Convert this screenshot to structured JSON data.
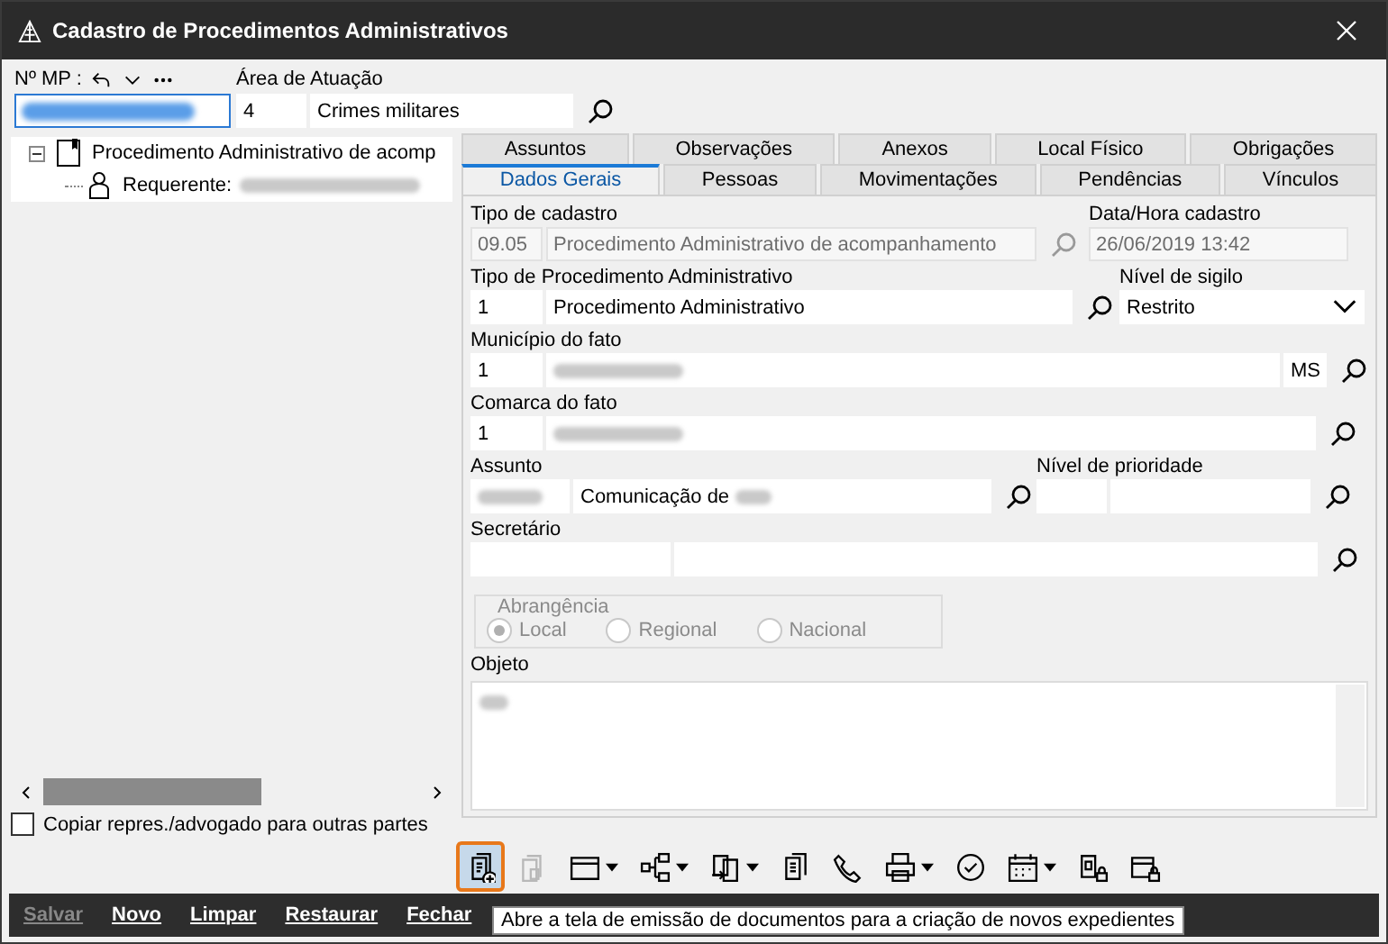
{
  "window": {
    "title": "Cadastro de Procedimentos Administrativos"
  },
  "header": {
    "mp_label": "Nº MP :",
    "area_label": "Área de Atuação",
    "area_code": "4",
    "area_name": "Crimes militares"
  },
  "tree": [
    {
      "label": "Procedimento Administrativo de acomp",
      "expanded": true,
      "children": [
        {
          "label": "Requerente:"
        }
      ]
    }
  ],
  "copy_checkbox": {
    "label": "Copiar repres./advogado para outras partes",
    "checked": false
  },
  "tabs": {
    "back_row": [
      {
        "label": "Assuntos",
        "selected": false
      },
      {
        "label": "Observações",
        "selected": false
      },
      {
        "label": "Anexos",
        "selected": false
      },
      {
        "label": "Local Físico",
        "selected": false
      },
      {
        "label": "Obrigações",
        "selected": false
      }
    ],
    "front_row": [
      {
        "label": "Dados Gerais",
        "selected": true
      },
      {
        "label": "Pessoas",
        "selected": false
      },
      {
        "label": "Movimentações",
        "selected": false
      },
      {
        "label": "Pendências",
        "selected": false
      },
      {
        "label": "Vínculos",
        "selected": false
      }
    ]
  },
  "form": {
    "tipo_cadastro": {
      "label": "Tipo de cadastro",
      "code": "09.05",
      "value": "Procedimento Administrativo de acompanhamento",
      "disabled": true
    },
    "data_hora": {
      "label": "Data/Hora cadastro",
      "value": "26/06/2019 13:42",
      "disabled": true
    },
    "tipo_procedimento": {
      "label": "Tipo de Procedimento Administrativo",
      "code": "1",
      "value": "Procedimento Administrativo",
      "disabled": false
    },
    "sigilo": {
      "label": "Nível de sigilo",
      "value": "Restrito"
    },
    "municipio": {
      "label": "Município do fato",
      "code": "1",
      "uf": "MS"
    },
    "comarca": {
      "label": "Comarca do fato",
      "code": "1"
    },
    "assunto": {
      "label": "Assunto",
      "value": "Comunicação de"
    },
    "prioridade": {
      "label": "Nível de prioridade"
    },
    "secretario": {
      "label": "Secretário"
    },
    "abrangencia": {
      "label": "Abrangência",
      "disabled": true,
      "options": [
        {
          "label": "Local",
          "selected": true
        },
        {
          "label": "Regional",
          "selected": false
        },
        {
          "label": "Nacional",
          "selected": false
        }
      ]
    },
    "objeto": {
      "label": "Objeto"
    }
  },
  "toolbar": [
    {
      "kind": "button",
      "disabled": false,
      "selected": true
    },
    {
      "kind": "button",
      "disabled": true,
      "selected": false
    },
    {
      "kind": "dropdown",
      "disabled": false,
      "selected": false
    },
    {
      "kind": "dropdown",
      "disabled": false,
      "selected": false
    },
    {
      "kind": "dropdown",
      "disabled": false,
      "selected": false
    },
    {
      "kind": "button",
      "disabled": false,
      "selected": false
    },
    {
      "kind": "button",
      "disabled": false,
      "selected": false
    },
    {
      "kind": "dropdown",
      "disabled": false,
      "selected": false
    },
    {
      "kind": "button",
      "disabled": false,
      "selected": false
    },
    {
      "kind": "dropdown",
      "disabled": false,
      "selected": false
    },
    {
      "kind": "button",
      "disabled": false,
      "selected": false
    },
    {
      "kind": "button",
      "disabled": false,
      "selected": false
    }
  ],
  "tooltip": "Abre a tela de emissão de documentos para a criação de novos expedientes",
  "actions": [
    {
      "label": "Salvar",
      "disabled": true
    },
    {
      "label": "Novo",
      "disabled": false
    },
    {
      "label": "Limpar",
      "disabled": false
    },
    {
      "label": "Restaurar",
      "disabled": false
    },
    {
      "label": "Fechar",
      "disabled": false
    }
  ]
}
